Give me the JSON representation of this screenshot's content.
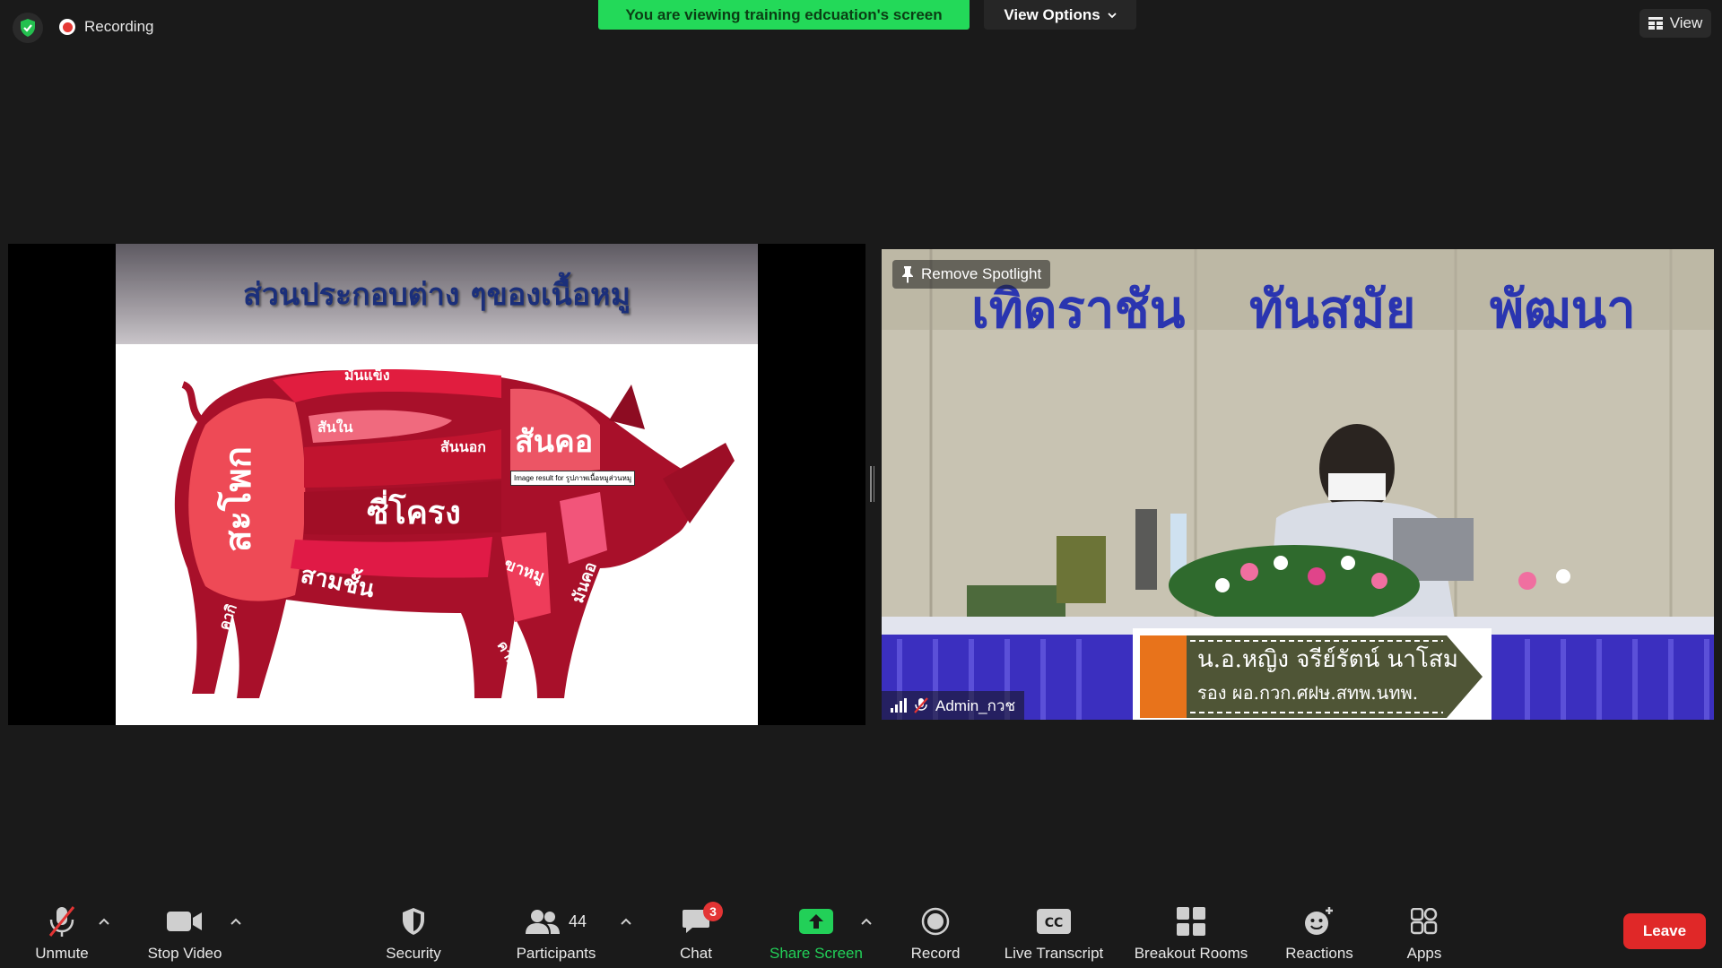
{
  "top": {
    "recording_label": "Recording",
    "viewing_banner": "You are viewing training edcuation's screen",
    "view_options_label": "View Options",
    "view_label": "View"
  },
  "share": {
    "slide_title": "ส่วนประกอบต่าง ๆของเนื้อหมู",
    "tooltip": "Image result for รูปภาพเนื้อหมูส่วนหมู",
    "pig_labels": [
      "มันแข็ง",
      "สันใน",
      "สันนอก",
      "สันคอ",
      "สะโพก",
      "ซี่โครง",
      "สามชั้น",
      "ขาหมู",
      "มันคอ",
      "คากิ",
      "คากิ"
    ]
  },
  "video": {
    "banner_words": [
      "เทิดราชัน",
      "ทันสมัย",
      "พัฒนา"
    ],
    "remove_spotlight": "Remove Spotlight",
    "participant_name": "Admin_กวช",
    "caption_line1": "น.อ.หญิง จรีย์รัตน์  นาโสม",
    "caption_line2": "รอง ผอ.กวก.ศฝษ.สทพ.นทพ."
  },
  "toolbar": {
    "unmute": "Unmute",
    "stop_video": "Stop Video",
    "security": "Security",
    "participants": "Participants",
    "participants_count": "44",
    "chat": "Chat",
    "chat_badge": "3",
    "share_screen": "Share Screen",
    "record": "Record",
    "live_transcript": "Live Transcript",
    "breakout_rooms": "Breakout Rooms",
    "reactions": "Reactions",
    "apps": "Apps",
    "leave": "Leave"
  },
  "colors": {
    "green": "#23d959",
    "leave_red": "#e02828",
    "badge_red": "#e33434"
  }
}
